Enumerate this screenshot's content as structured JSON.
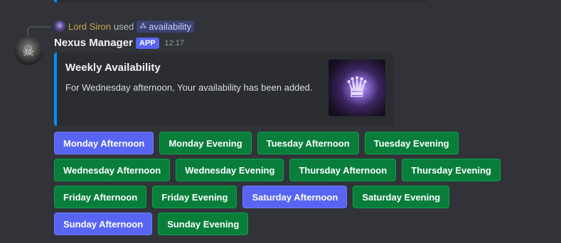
{
  "reply": {
    "user": "Lord Siron",
    "used_text": "used",
    "command": "availability"
  },
  "message": {
    "author": "Nexus Manager",
    "badge": "APP",
    "time": "12:17"
  },
  "embed": {
    "title": "Weekly Availability",
    "description": "For Wednesday afternoon, Your availability has been added."
  },
  "buttons": [
    [
      {
        "label": "Monday Afternoon",
        "style": "primary"
      },
      {
        "label": "Monday Evening",
        "style": "success"
      },
      {
        "label": "Tuesday Afternoon",
        "style": "success"
      },
      {
        "label": "Tuesday Evening",
        "style": "success"
      }
    ],
    [
      {
        "label": "Wednesday Afternoon",
        "style": "success"
      },
      {
        "label": "Wednesday Evening",
        "style": "success"
      },
      {
        "label": "Thursday Afternoon",
        "style": "success"
      },
      {
        "label": "Thursday Evening",
        "style": "success"
      }
    ],
    [
      {
        "label": "Friday Afternoon",
        "style": "success"
      },
      {
        "label": "Friday Evening",
        "style": "success"
      },
      {
        "label": "Saturday Afternoon",
        "style": "primary"
      },
      {
        "label": "Saturday Evening",
        "style": "success"
      }
    ],
    [
      {
        "label": "Sunday Afternoon",
        "style": "primary"
      },
      {
        "label": "Sunday Evening",
        "style": "success"
      }
    ]
  ],
  "colors": {
    "background": "#313338",
    "embed_accent": "#0091ff",
    "success": "#087e3a",
    "primary": "#5865f2",
    "reply_user": "#c5a44b"
  }
}
